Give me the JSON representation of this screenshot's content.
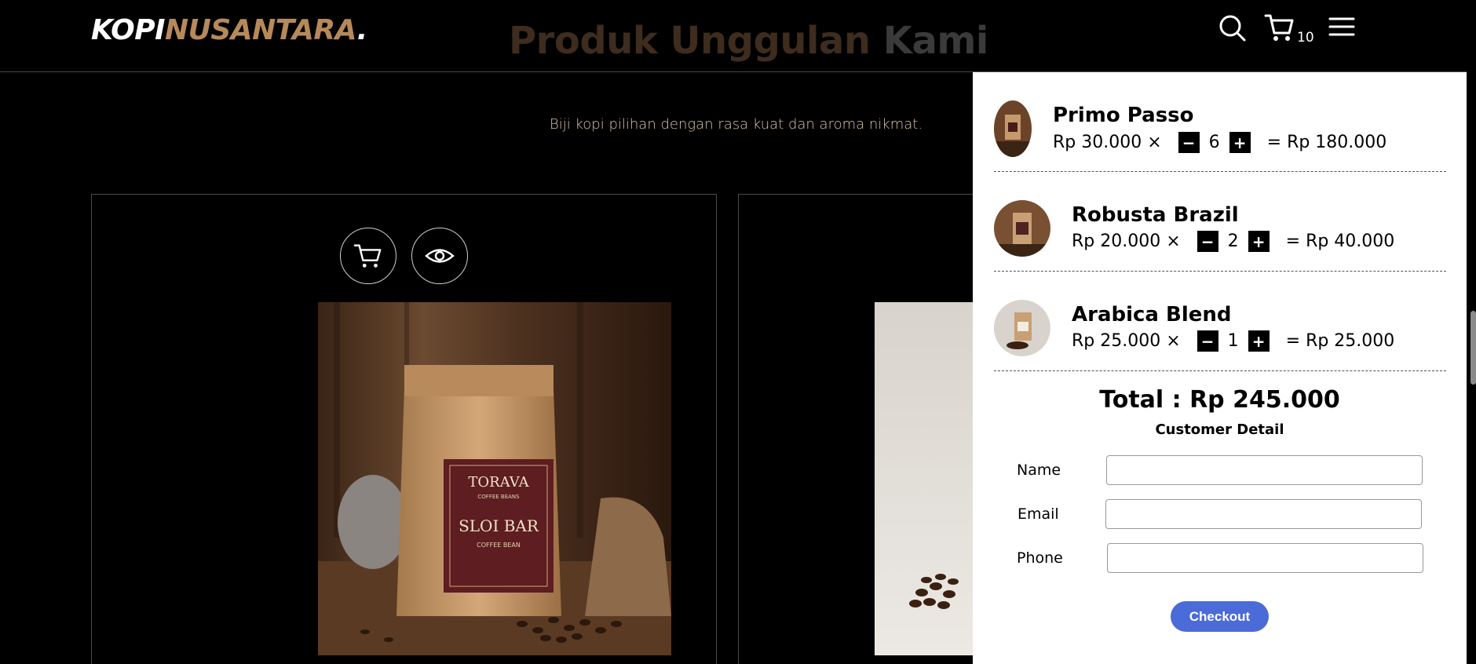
{
  "header": {
    "logo": {
      "part1": "KOPI",
      "part2": "NUSANTARA",
      "part3": "."
    },
    "section_title": {
      "part1": "Produk Unggulan ",
      "part2": "Kami"
    },
    "cart_count": "10"
  },
  "products_section": {
    "subtitle": "Biji kopi pilihan dengan rasa kuat dan aroma nikmat."
  },
  "product_card_1": {
    "bag_brand": "TORAVA",
    "bag_subbrand": "COFFEE BEANS",
    "bag_title": "SLOI BAR",
    "bag_tag": "COFFEE BEAN"
  },
  "cart": {
    "items": [
      {
        "name": "Primo Passo",
        "price": "Rp 30.000",
        "times": "×",
        "qty": "6",
        "subtotal": "= Rp 180.000",
        "minus": "−",
        "plus": "+"
      },
      {
        "name": "Robusta Brazil",
        "price": "Rp 20.000",
        "times": "×",
        "qty": "2",
        "subtotal": "= Rp 40.000",
        "minus": "−",
        "plus": "+"
      },
      {
        "name": "Arabica Blend",
        "price": "Rp 25.000",
        "times": "×",
        "qty": "1",
        "subtotal": "= Rp 25.000",
        "minus": "−",
        "plus": "+"
      }
    ],
    "total": "Total : Rp 245.000",
    "customer_detail": "Customer Detail",
    "form": {
      "name_label": "Name",
      "email_label": "Email",
      "phone_label": "Phone",
      "name_value": "",
      "email_value": "",
      "phone_value": ""
    },
    "checkout_label": "Checkout"
  },
  "colors": {
    "accent_brown": "#b6895b",
    "checkout_blue": "#4a6bd8",
    "background": "#000000"
  },
  "icons": [
    "search-icon",
    "cart-icon",
    "menu-icon",
    "eye-icon"
  ]
}
